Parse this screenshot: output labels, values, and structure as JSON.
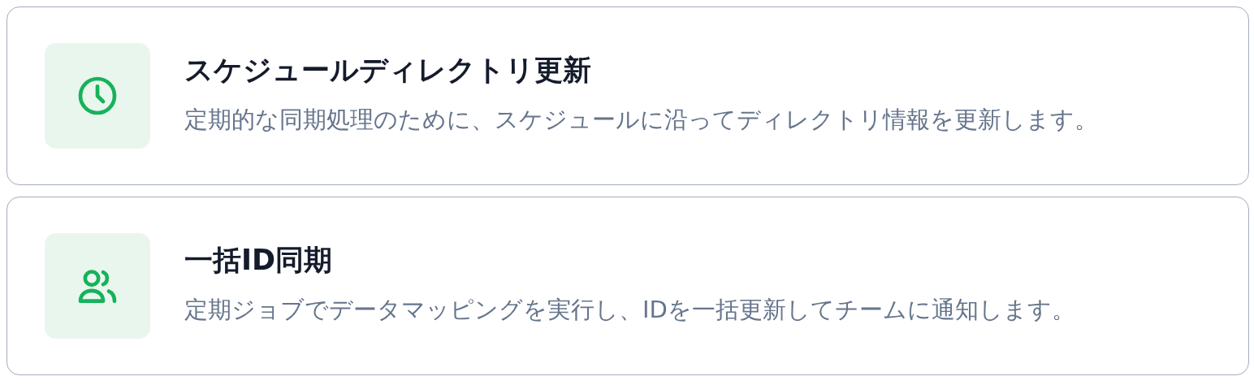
{
  "cards": [
    {
      "kind": "clock",
      "title": "スケジュールディレクトリ更新",
      "description": "定期的な同期処理のために、スケジュールに沿ってディレクトリ情報を更新します。"
    },
    {
      "kind": "people",
      "title": "一括ID同期",
      "description": "定期ジョブでデータマッピングを実行し、IDを一括更新してチームに通知します。"
    }
  ]
}
